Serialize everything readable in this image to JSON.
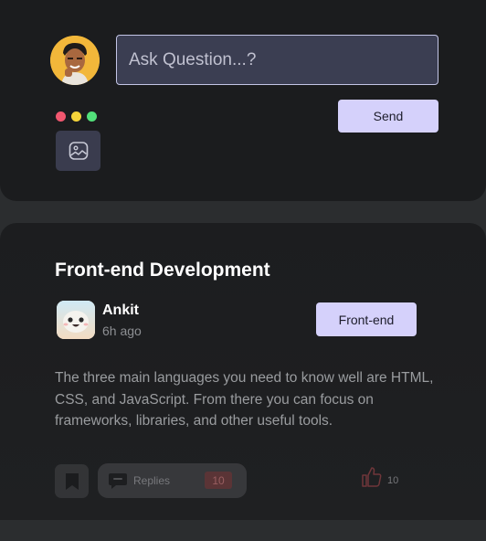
{
  "ask": {
    "placeholder": "Ask Question...?",
    "send_label": "Send",
    "dot_colors": [
      "#f1576f",
      "#f5d43a",
      "#52e07a"
    ]
  },
  "post": {
    "title": "Front-end Development",
    "author": "Ankit",
    "time": "6h ago",
    "tag": "Front-end",
    "body": "The three main languages you need to know well are HTML, CSS, and JavaScript. From there you can focus on frameworks, libraries, and other useful tools.",
    "replies_label": "Replies",
    "replies_count": "10",
    "like_count": "10"
  },
  "colors": {
    "accent": "#d5d1fb",
    "input_bg": "#3b3e52",
    "card_bg": "#1b1c1e",
    "page_bg": "#2b2d2f"
  },
  "icons": [
    "user-avatar",
    "image-icon",
    "author-avatar",
    "bookmark-icon",
    "chat-bubble-icon",
    "thumbs-up-icon"
  ]
}
